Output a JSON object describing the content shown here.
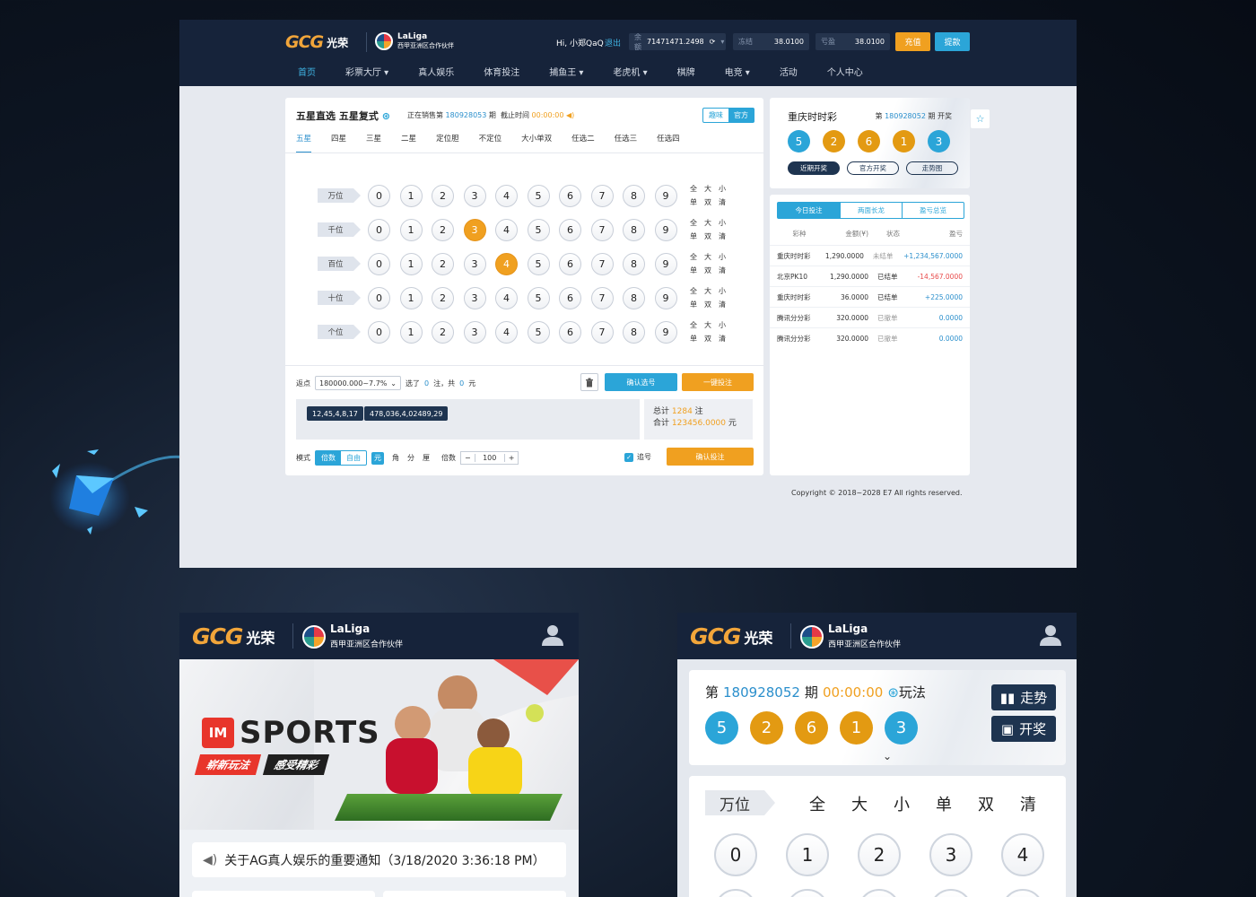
{
  "brand": {
    "gcg": "GCG",
    "gcg_cn": "光荣",
    "laliga": "LaLiga",
    "laliga_sub": "西甲亚洲区合作伙伴"
  },
  "header": {
    "greeting": "Hi, 小郑QaQ",
    "logout": "退出",
    "balance_label": "余额",
    "balance_value": "71471471.2498",
    "frozen_label": "冻结",
    "frozen_value": "38.0100",
    "profit_label": "亏盈",
    "profit_value": "38.0100",
    "recharge": "充值",
    "withdraw": "提款"
  },
  "nav": [
    {
      "label": "首页",
      "active": true
    },
    {
      "label": "彩票大厅 ▾"
    },
    {
      "label": "真人娱乐"
    },
    {
      "label": "体育投注"
    },
    {
      "label": "捕鱼王 ▾"
    },
    {
      "label": "老虎机 ▾"
    },
    {
      "label": "棋牌"
    },
    {
      "label": "电竞 ▾"
    },
    {
      "label": "活动"
    },
    {
      "label": "个人中心"
    }
  ],
  "game": {
    "title": "五星直选 五星复式",
    "selling_prefix": "正在销售第",
    "period": "180928053",
    "period_suffix": "期",
    "deadline_label": "截止时间",
    "deadline": "00:00:00",
    "mode_fun": "趣味",
    "mode_official": "官方",
    "tabs": [
      "五星",
      "四星",
      "三星",
      "二星",
      "定位胆",
      "不定位",
      "大小单双",
      "任选二",
      "任选三",
      "任选四"
    ],
    "positions": [
      "万位",
      "千位",
      "百位",
      "十位",
      "个位"
    ],
    "digits": [
      "0",
      "1",
      "2",
      "3",
      "4",
      "5",
      "6",
      "7",
      "8",
      "9"
    ],
    "selected": {
      "千位": "3",
      "百位": "4"
    },
    "quick": [
      "全",
      "大",
      "小",
      "单",
      "双",
      "清"
    ],
    "rebate_label": "返点",
    "rebate_value": "180000.000~7.7%",
    "picked_prefix": "选了",
    "picked_count": "0",
    "picked_mid": "注，共",
    "picked_amount": "0",
    "picked_suffix": "元",
    "confirm_numbers": "确认选号",
    "quick_bet": "一键投注",
    "chips": [
      "12,45,4,8,17",
      "478,036,4,02489,29"
    ],
    "total_label": "总计",
    "total_bets": "1284",
    "total_unit": "注",
    "sum_label": "合计",
    "sum_value": "123456.0000",
    "sum_unit": "元",
    "mode_label": "模式",
    "mode_multiple": "倍数",
    "mode_free": "自由",
    "unit_yuan": "元",
    "unit_jiao": "角",
    "unit_fen": "分",
    "unit_li": "厘",
    "multiple_label": "倍数",
    "multiple_value": "100",
    "chase_label": "追号",
    "confirm_bet": "确认投注"
  },
  "draw": {
    "title": "重庆时时彩",
    "period_prefix": "第",
    "period": "180928052",
    "period_suffix": "期 开奖",
    "balls": [
      "5",
      "2",
      "6",
      "1",
      "3"
    ],
    "ball_colors": [
      "blue",
      "gold",
      "gold",
      "gold",
      "blue"
    ],
    "btn_recent": "近期开奖",
    "btn_official": "官方开奖",
    "btn_trend": "走势图"
  },
  "records": {
    "tabs": [
      "今日投注",
      "两面长龙",
      "盈亏总览"
    ],
    "headers": [
      "彩种",
      "金额(¥)",
      "状态",
      "盈亏"
    ],
    "rows": [
      {
        "game": "重庆时时彩",
        "amount": "1,290.0000",
        "status": "未结单",
        "pnl": "+1,234,567.0000",
        "kind": "pos"
      },
      {
        "game": "北京PK10",
        "amount": "1,290.0000",
        "status": "已结单",
        "pnl": "-14,567.0000",
        "kind": "neg"
      },
      {
        "game": "重庆时时彩",
        "amount": "36.0000",
        "status": "已结单",
        "pnl": "+225.0000",
        "kind": "pos"
      },
      {
        "game": "腾讯分分彩",
        "amount": "320.0000",
        "status": "已撤单",
        "pnl": "0.0000",
        "kind": "pos"
      },
      {
        "game": "腾讯分分彩",
        "amount": "320.0000",
        "status": "已撤单",
        "pnl": "0.0000",
        "kind": "pos"
      }
    ]
  },
  "copyright": "Copyright © 2018~2028 E7 All rights reserved.",
  "mobile_left": {
    "banner_im": "IM",
    "banner_sports": "SPORTS",
    "banner_slogan1": "崭新玩法",
    "banner_slogan2": "感受精彩",
    "notice": "关于AG真人娱乐的重要通知（3/18/2020 3:36:18 PM）"
  },
  "mobile_right": {
    "period_prefix": "第",
    "period": "180928052",
    "period_suffix": "期",
    "countdown": "00:00:00",
    "play_label": "玩法",
    "balls": [
      "5",
      "2",
      "6",
      "1",
      "3"
    ],
    "trend_btn": "走势",
    "draw_btn": "开奖",
    "position": "万位",
    "quick": [
      "全",
      "大",
      "小",
      "单",
      "双",
      "清"
    ],
    "digits": [
      "0",
      "1",
      "2",
      "3",
      "4"
    ]
  },
  "colors": {
    "accent_blue": "#2ba5d8",
    "accent_orange": "#f0a020",
    "header_bg": "#16233a"
  }
}
